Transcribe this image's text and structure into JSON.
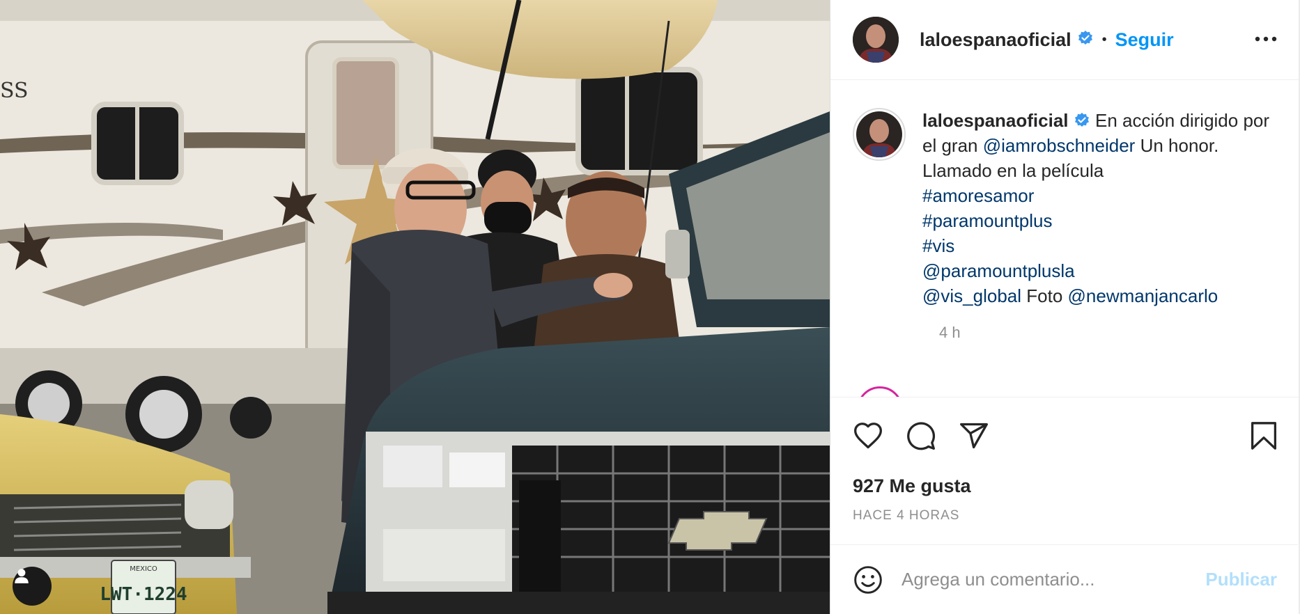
{
  "post": {
    "username": "laloespanaoficial",
    "follow_label": "Seguir",
    "separator": "•"
  },
  "caption": {
    "username": "laloespanaoficial",
    "text1": " En acción dirigido por el gran ",
    "mention1": "@iamrobschneider",
    "text2": " Un honor. Llamado en la película ",
    "hashtag1": "#amoresamor",
    "hashtag2": "#paramountplus",
    "hashtag3": "#vis",
    "mention2": "@paramountplusla",
    "mention3": "@vis_global",
    "text3": " Foto ",
    "mention4": "@newmanjancarlo",
    "time": "4 h"
  },
  "engagement": {
    "likes": "927 Me gusta",
    "timestamp": "HACE 4 HORAS"
  },
  "comment_box": {
    "placeholder": "Agrega un comentario...",
    "publish_label": "Publicar"
  },
  "photo": {
    "license_plate": "LWT·1224",
    "plate_top": "MEXICO"
  },
  "colors": {
    "link": "#00376b",
    "follow": "#0095f6",
    "verified": "#3897f0",
    "publish_disabled": "#b2dffc",
    "muted": "#8e8e8e"
  },
  "icons": [
    "verified-badge-icon",
    "more-options-icon",
    "heart-icon",
    "comment-icon",
    "share-icon",
    "bookmark-icon",
    "emoji-icon",
    "user-tag-icon"
  ]
}
